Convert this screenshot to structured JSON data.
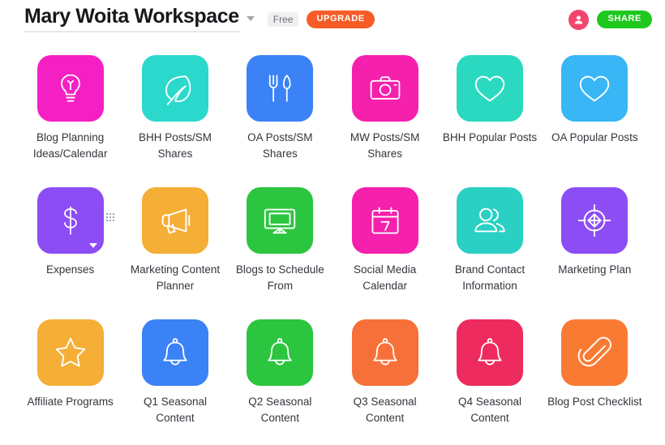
{
  "header": {
    "workspace_title": "Mary Woita Workspace",
    "workspace_caret_icon": "chevron-down-icon",
    "plan_badge": "Free",
    "upgrade_label": "UPGRADE",
    "avatar_icon": "user-avatar-icon",
    "share_label": "SHARE",
    "share_color": "#1ec81e",
    "upgrade_color": "#f75c27",
    "avatar_color": "#f2456b"
  },
  "grid": {
    "tiles": [
      {
        "label": "Blog Planning Ideas/Calendar",
        "icon": "lightbulb-icon",
        "color": "#f520c4"
      },
      {
        "label": "BHH Posts/SM Shares",
        "icon": "leaf-icon",
        "color": "#2bd9cc"
      },
      {
        "label": "OA Posts/SM Shares",
        "icon": "fork-knife-icon",
        "color": "#3b82f6"
      },
      {
        "label": "MW Posts/SM Shares",
        "icon": "camera-icon",
        "color": "#f520ac"
      },
      {
        "label": "BHH Popular Posts",
        "icon": "heart-icon",
        "color": "#2bd9c0"
      },
      {
        "label": "OA Popular Posts",
        "icon": "heart-icon",
        "color": "#38b6f5"
      },
      {
        "label": "Expenses",
        "icon": "dollar-sign-icon",
        "color": "#8c4df5",
        "hovered": true
      },
      {
        "label": "Marketing Content Planner",
        "icon": "megaphone-icon",
        "color": "#f5ae36"
      },
      {
        "label": "Blogs to Schedule From",
        "icon": "monitor-icon",
        "color": "#2cc53f"
      },
      {
        "label": "Social Media Calendar",
        "icon": "calendar-7-icon",
        "color": "#f520ac"
      },
      {
        "label": "Brand Contact Information",
        "icon": "people-icon",
        "color": "#2bd0c4"
      },
      {
        "label": "Marketing Plan",
        "icon": "target-icon",
        "color": "#8c4df5"
      },
      {
        "label": "Affiliate Programs",
        "icon": "star-icon",
        "color": "#f5ae36"
      },
      {
        "label": "Q1 Seasonal Content",
        "icon": "bell-icon",
        "color": "#3b82f6"
      },
      {
        "label": "Q2 Seasonal Content",
        "icon": "bell-icon",
        "color": "#2cc53f"
      },
      {
        "label": "Q3 Seasonal Content",
        "icon": "bell-icon",
        "color": "#f7703a"
      },
      {
        "label": "Q4 Seasonal Content",
        "icon": "bell-icon",
        "color": "#ee2b5e"
      },
      {
        "label": "Blog Post Checklist",
        "icon": "paperclip-icon",
        "color": "#f97b33"
      }
    ]
  }
}
